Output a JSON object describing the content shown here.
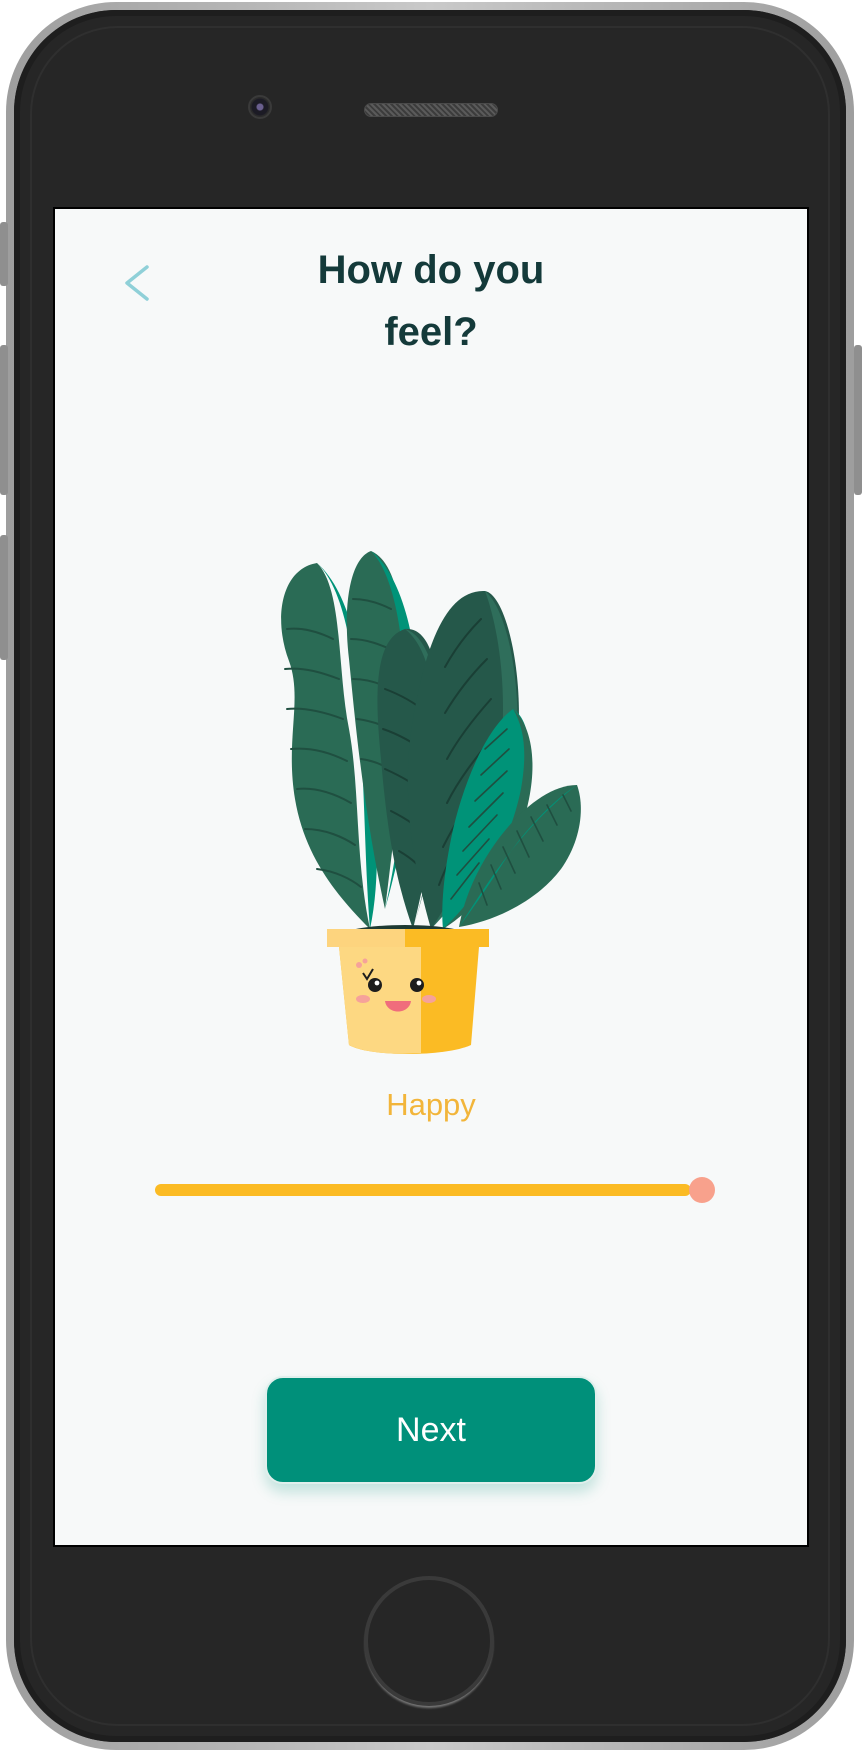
{
  "header": {
    "back_icon": "chevron-left-icon",
    "title_line1": "How do you",
    "title_line2": "feel?"
  },
  "illustration": {
    "icon": "smiling-potted-plant-illustration"
  },
  "mood": {
    "label": "Happy",
    "slider_value": 1.0
  },
  "actions": {
    "next_label": "Next"
  },
  "colors": {
    "title": "#143a3a",
    "accent_teal": "#00907a",
    "mood_text": "#f2b53a",
    "slider_track": "#fbbb24",
    "slider_thumb": "#f8a18c",
    "back_icon": "#8fd0d8"
  }
}
